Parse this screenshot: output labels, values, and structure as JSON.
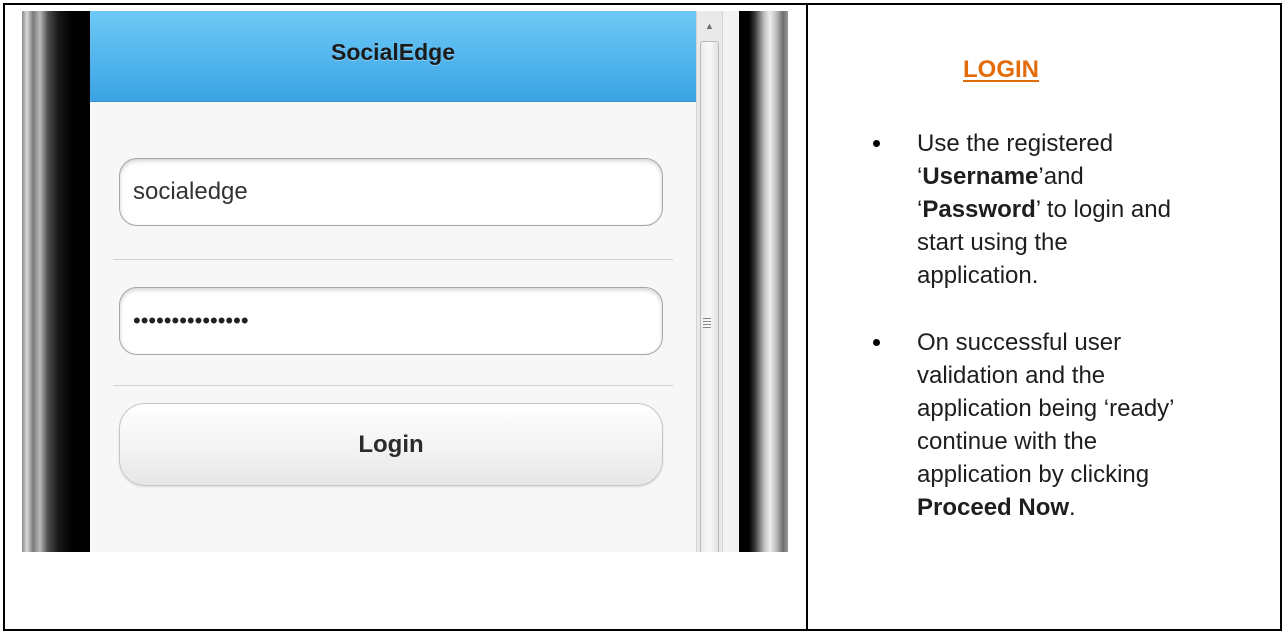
{
  "phone": {
    "app_title": "SocialEdge",
    "username_value": "socialedge",
    "password_masked": "•••••••••••••••",
    "login_button_label": "Login"
  },
  "instructions": {
    "heading": "LOGIN",
    "bullet1": {
      "t1": "Use the registered",
      "q1": "‘",
      "username": "Username",
      "q2": "’and",
      "q3": "‘",
      "password": "Password",
      "t2": "’ to login and",
      "t3": "start using the",
      "t4": "application."
    },
    "bullet2": {
      "t1": "On successful user",
      "t2": "validation and the",
      "t3": "application being ‘ready’",
      "t4": "continue with the",
      "t5": "application by clicking",
      "proceed": "Proceed Now",
      "t6": "."
    }
  }
}
